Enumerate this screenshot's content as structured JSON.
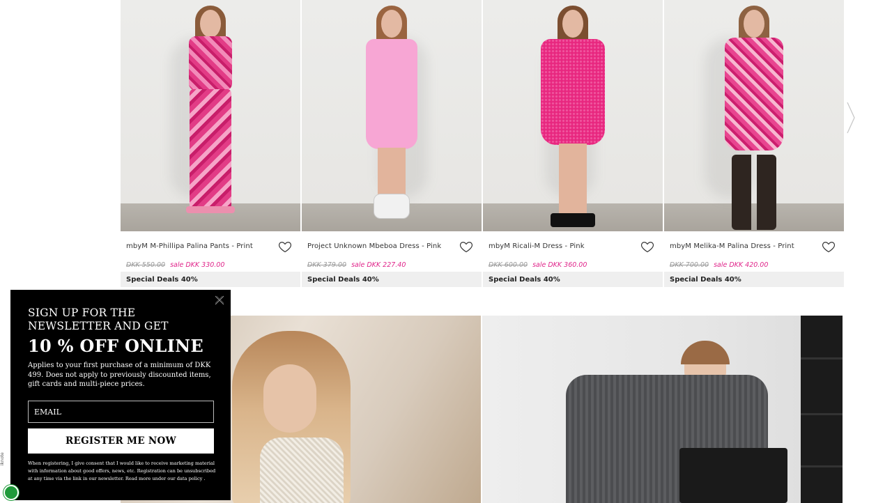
{
  "products": [
    {
      "name": "mbyM M-Phillipa Palina Pants - Print",
      "old_price": "DKK 550.00",
      "sale_price": "sale DKK 330.00",
      "deal": "Special Deals 40%"
    },
    {
      "name": "Project Unknown Mbeboa Dress - Pink",
      "old_price": "DKK 379.00",
      "sale_price": "sale DKK 227.40",
      "deal": "Special Deals 40%"
    },
    {
      "name": "mbyM Ricali-M Dress - Pink",
      "old_price": "DKK 600.00",
      "sale_price": "sale DKK 360.00",
      "deal": "Special Deals 40%"
    },
    {
      "name": "mbyM Melika-M Palina Dress - Print",
      "old_price": "DKK 700.00",
      "sale_price": "sale DKK 420.00",
      "deal": "Special Deals 40%"
    }
  ],
  "newsletter": {
    "title": "Sign up for the newsletter and get",
    "offer": "10 % OFF ONLINE",
    "description": "Applies to your first purchase of a minimum of DKK 499. Does not apply to previously discounted items, gift cards and multi-piece prices.",
    "email_placeholder": "EMAIL",
    "register_label": "REGISTER ME NOW",
    "consent": "When registering, I give consent that I would like to receive marketing material with information about good offers, news, etc. Registration can be unsubscribed at any time via the link in our newsletter. Read more under our  data policy ."
  },
  "badge_label": "iknote",
  "colors": {
    "sale": "#e0248a",
    "popup_bg": "#000000",
    "deal_bg": "#efefef"
  },
  "icons": [
    "heart-icon",
    "close-icon",
    "chevron-right-icon"
  ]
}
